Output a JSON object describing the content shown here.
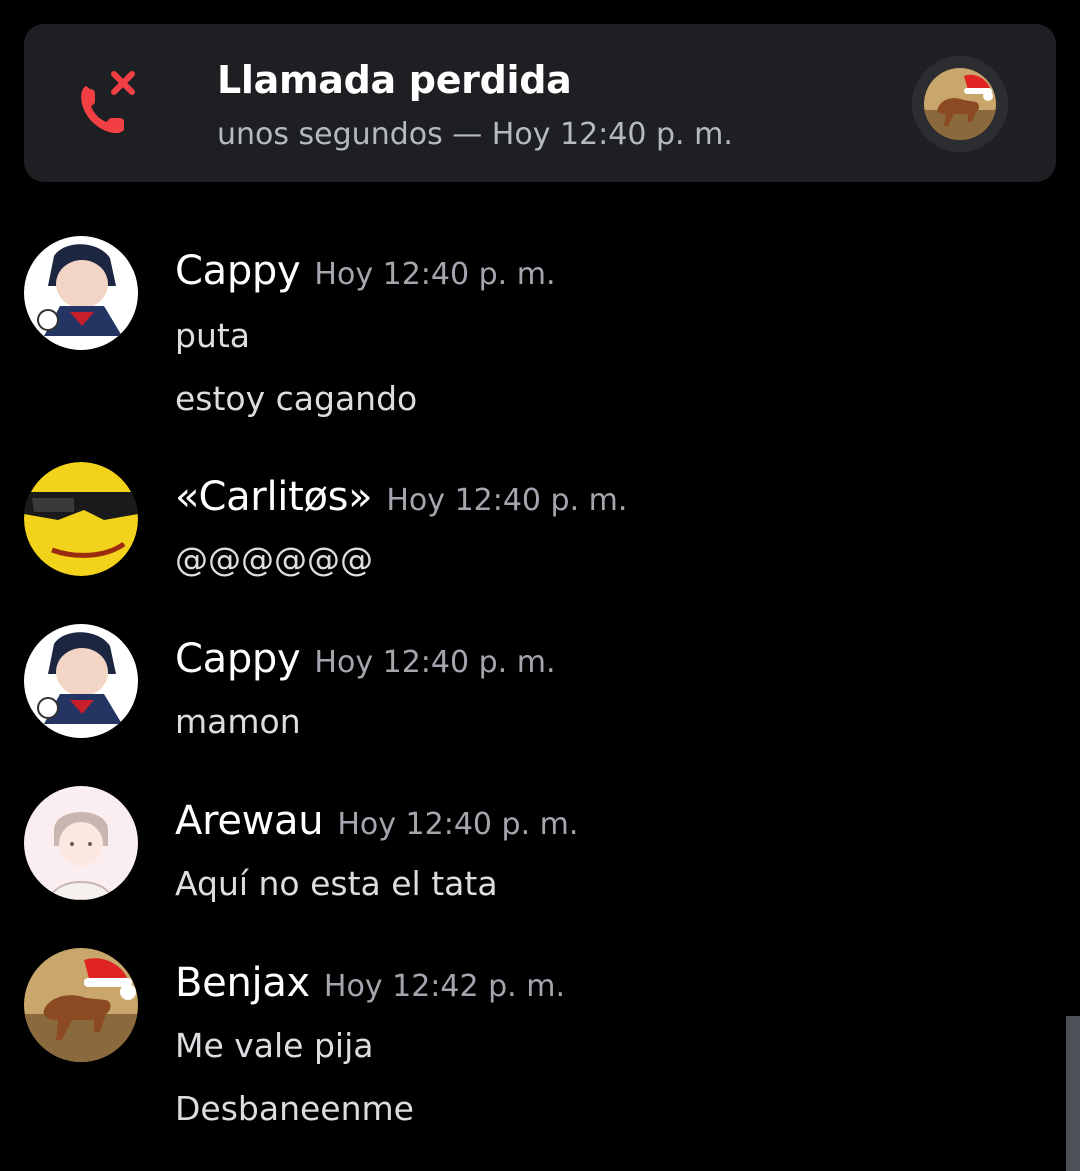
{
  "call": {
    "title": "Llamada perdida",
    "subtitle": "unos segundos — Hoy 12:40 p. m.",
    "icon": "missed-call-icon",
    "accent": "#f23f43"
  },
  "messages": [
    {
      "username": "Cappy",
      "timestamp": "Hoy 12:40 p. m.",
      "lines": [
        "puta",
        "estoy cagando"
      ]
    },
    {
      "username": "«Carlitøs»",
      "timestamp": "Hoy 12:40 p. m.",
      "lines": [
        "@@@@@@"
      ]
    },
    {
      "username": "Cappy",
      "timestamp": "Hoy 12:40 p. m.",
      "lines": [
        "mamon"
      ]
    },
    {
      "username": "Arewau",
      "timestamp": "Hoy 12:40 p. m.",
      "lines": [
        "Aquí no esta el tata"
      ]
    },
    {
      "username": "Benjax",
      "timestamp": "Hoy 12:42 p. m.",
      "lines": [
        "Me vale pija",
        "Desbaneenme"
      ]
    }
  ],
  "colors": {
    "background": "#000000",
    "card": "#1e1f22",
    "username": "#ffffff",
    "timestamp": "#a3a6ad",
    "text": "#dcdde1"
  }
}
